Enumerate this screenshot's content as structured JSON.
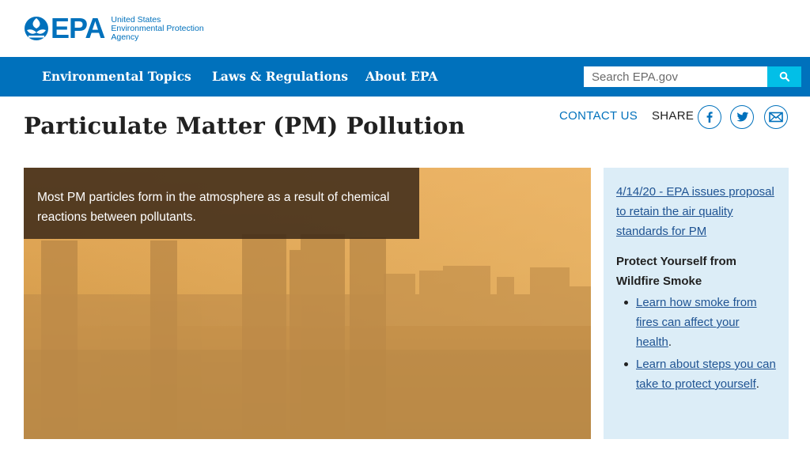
{
  "header": {
    "logo_text": "EPA",
    "agency_lines": [
      "United States",
      "Environmental Protection",
      "Agency"
    ]
  },
  "nav": {
    "items": [
      {
        "label": "Environmental Topics"
      },
      {
        "label": "Laws & Regulations"
      },
      {
        "label": "About EPA"
      }
    ],
    "search_placeholder": "Search EPA.gov",
    "search_icon": "search-icon"
  },
  "page": {
    "title": "Particulate Matter (PM) Pollution",
    "contact_label": "CONTACT US",
    "share_label": "SHARE",
    "share_icons": [
      "facebook-icon",
      "twitter-icon",
      "email-icon"
    ]
  },
  "hero": {
    "caption": "Most PM particles form in the atmosphere as a result of chemical reactions between pollutants."
  },
  "sidebar": {
    "news_link": "4/14/20 - EPA issues proposal to retain the air quality standards for PM",
    "heading": "Protect Yourself from Wildfire Smoke",
    "items": [
      {
        "link": "Learn how smoke from fires can affect your health",
        "suffix": "."
      },
      {
        "link": "Learn about steps you can take to protect yourself",
        "suffix": "."
      }
    ]
  },
  "colors": {
    "brand_blue": "#0071bc",
    "search_button": "#02bfe7",
    "sidebar_bg": "#dcedf7",
    "link": "#205493"
  }
}
